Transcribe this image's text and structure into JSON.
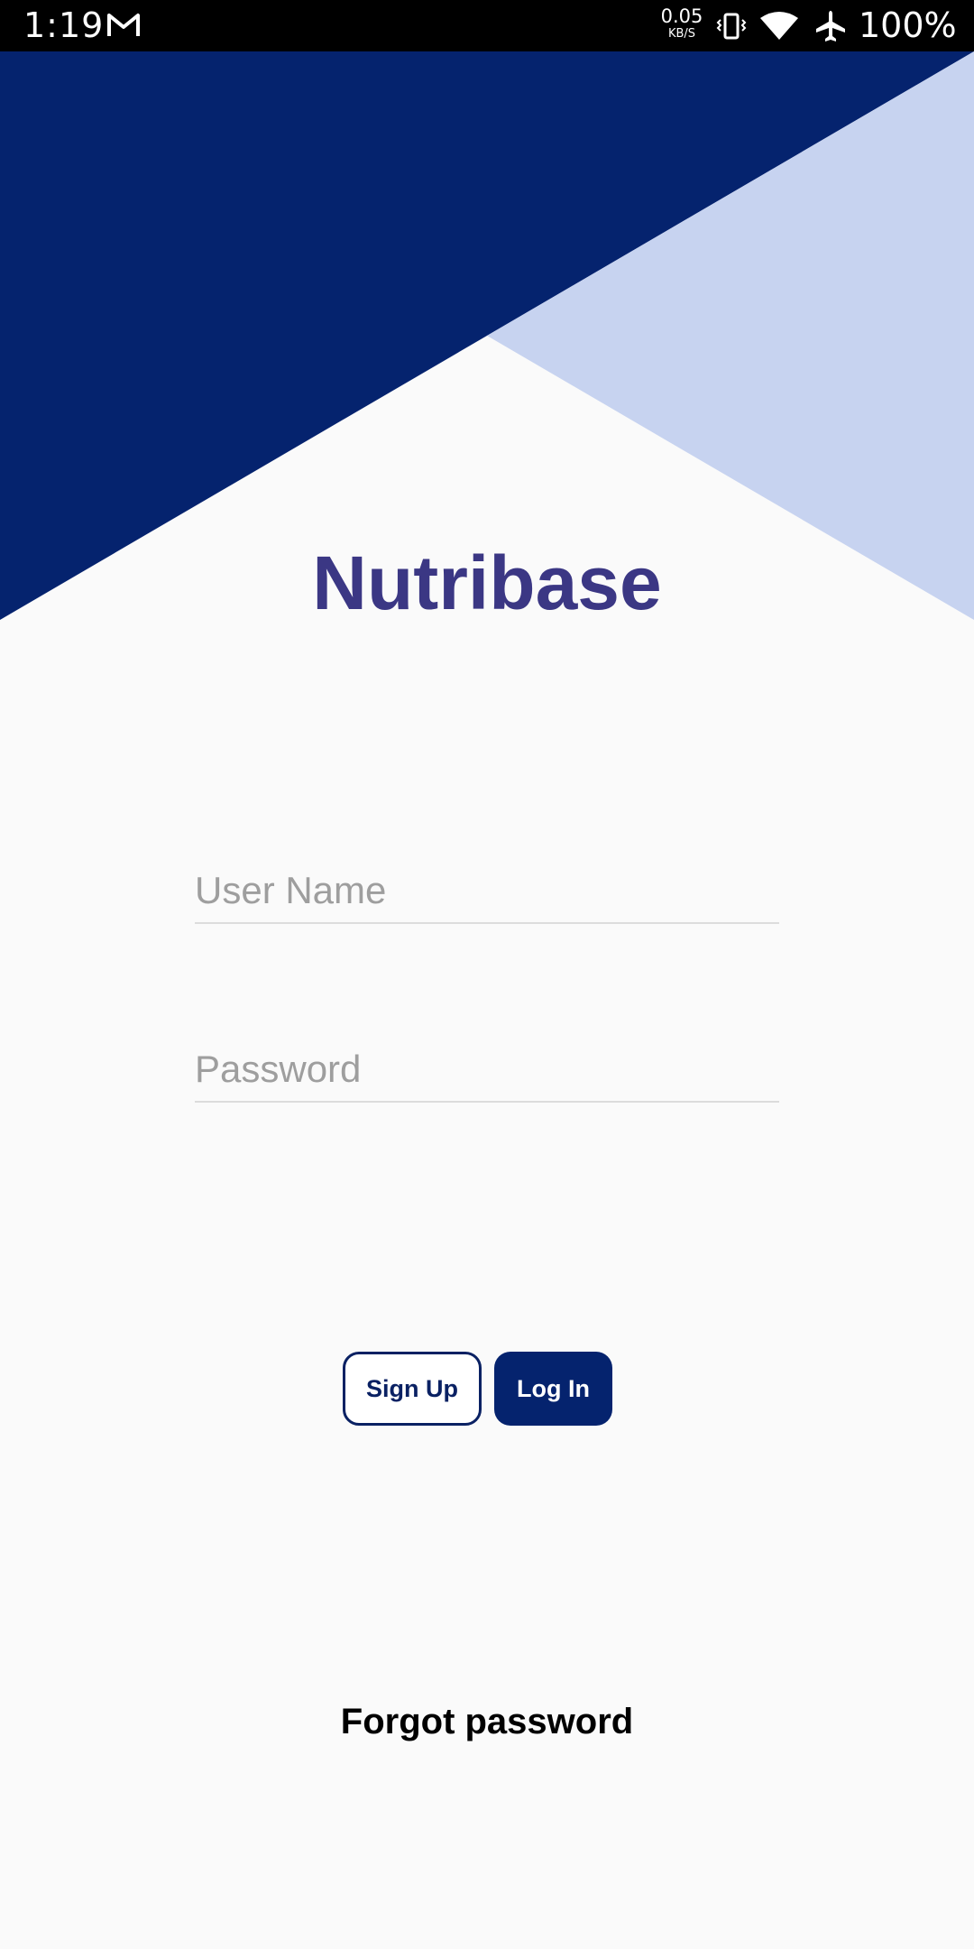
{
  "status_bar": {
    "time": "1:19",
    "net_speed_value": "0.05",
    "net_speed_unit": "KB/S",
    "battery": "100%",
    "icons": [
      "gmail-icon",
      "vibrate-icon",
      "wifi-icon",
      "airplane-icon"
    ]
  },
  "app": {
    "title": "Nutribase"
  },
  "form": {
    "username_placeholder": "User Name",
    "username_value": "",
    "password_placeholder": "Password",
    "password_value": ""
  },
  "buttons": {
    "signup_label": "Sign Up",
    "login_label": "Log In"
  },
  "links": {
    "forgot_password": "Forgot password"
  },
  "colors": {
    "navy": "#05236e",
    "light_blue": "#c7d3f0",
    "title": "#3b3784",
    "background": "#fafafa"
  }
}
